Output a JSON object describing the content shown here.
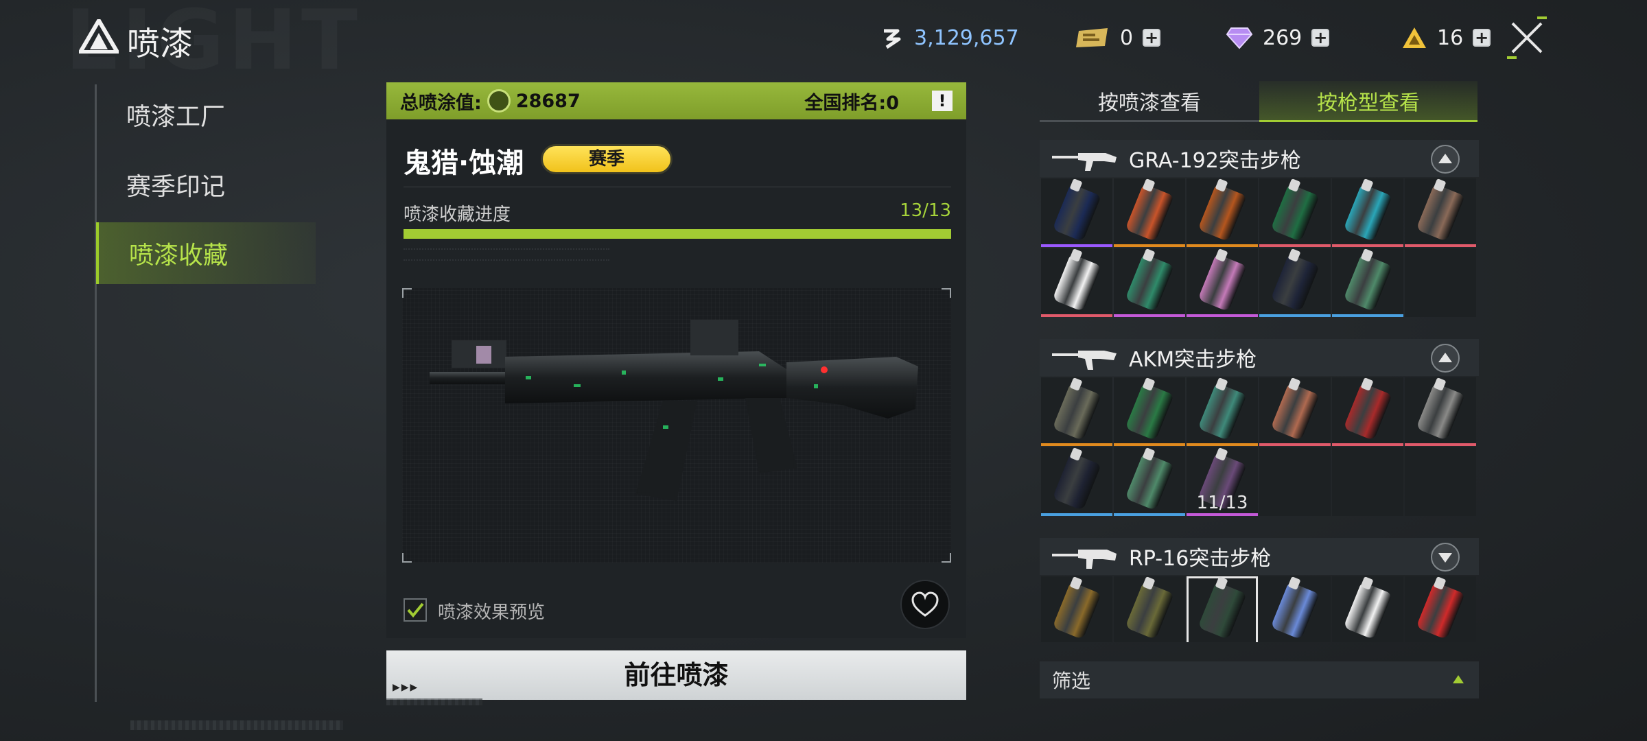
{
  "app": {
    "title": "喷漆",
    "bg_watermark": "LIGHT"
  },
  "currencies": [
    {
      "icon": "coin-icon",
      "value": "3,129,657",
      "color": "#8fc4ff"
    },
    {
      "icon": "ticket-icon",
      "value": "0",
      "color": "#f0f0f0"
    },
    {
      "icon": "diamond-icon",
      "value": "269",
      "color": "#f0f0f0"
    },
    {
      "icon": "triangle-token-icon",
      "value": "16",
      "color": "#f0f0f0"
    }
  ],
  "sidebar": {
    "items": [
      {
        "label": "喷漆工厂",
        "active": false
      },
      {
        "label": "赛季印记",
        "active": false
      },
      {
        "label": "喷漆收藏",
        "active": true
      }
    ]
  },
  "summary": {
    "total_label": "总喷涂值:",
    "total_value": "28687",
    "rank_label": "全国排名:0",
    "info_icon": "!"
  },
  "skin": {
    "name": "鬼猎·蚀潮",
    "badge": "赛季",
    "progress_label": "喷漆收藏进度",
    "progress_text": "13/13",
    "progress_fraction": 1.0,
    "preview_label": "喷漆效果预览",
    "preview_checked": true
  },
  "actions": {
    "go_label": "前往喷漆",
    "go_mark": "▶▶▶"
  },
  "tabs": [
    {
      "label": "按喷漆查看",
      "active": false
    },
    {
      "label": "按枪型查看",
      "active": true
    }
  ],
  "groups": [
    {
      "name": "GRA-192突击步枪",
      "expanded": true,
      "cells": [
        {
          "color": "#1b2a55",
          "rarity": "#9b59ff"
        },
        {
          "color": "#c9542a",
          "rarity": "#e08a1e"
        },
        {
          "color": "#b5561e",
          "rarity": "#e08a1e"
        },
        {
          "color": "#1f6e43",
          "rarity": "#e05a6a"
        },
        {
          "color": "#2aa6b8",
          "rarity": "#e05a6a"
        },
        {
          "color": "#8a6a58",
          "rarity": "#e05a6a"
        },
        {
          "color": "#f2f2f2",
          "rarity": "#e05a6a"
        },
        {
          "color": "#2f8b6a",
          "rarity": "#c45ad8"
        },
        {
          "color": "#c47ab8",
          "rarity": "#c45ad8"
        },
        {
          "color": "#1e2438",
          "rarity": "#4aa0e0"
        },
        {
          "color": "#4f8a6a",
          "rarity": "#4aa0e0"
        },
        {
          "color": "",
          "rarity": ""
        }
      ]
    },
    {
      "name": "AKM突击步枪",
      "expanded": true,
      "cells": [
        {
          "color": "#6a6b5a",
          "rarity": "#e08a1e"
        },
        {
          "color": "#2a7a45",
          "rarity": "#e08a1e"
        },
        {
          "color": "#3f8a7a",
          "rarity": "#e08a1e"
        },
        {
          "color": "#b06a50",
          "rarity": "#e05a6a"
        },
        {
          "color": "#a82a2a",
          "rarity": "#e05a6a"
        },
        {
          "color": "#8a8a88",
          "rarity": "#e05a6a"
        },
        {
          "color": "#1e2232",
          "rarity": "#4aa0e0"
        },
        {
          "color": "#4f8a6a",
          "rarity": "#4aa0e0"
        },
        {
          "color": "#6a4a78",
          "rarity": "#c45ad8",
          "progress": "11/13"
        },
        {
          "color": "",
          "rarity": ""
        },
        {
          "color": "",
          "rarity": ""
        },
        {
          "color": "",
          "rarity": ""
        }
      ]
    },
    {
      "name": "RP-16突击步枪",
      "expanded": false,
      "cells": [
        {
          "color": "#8a6a2a",
          "rarity": ""
        },
        {
          "color": "#6a6a38",
          "rarity": ""
        },
        {
          "color": "#2f4a3a",
          "rarity": "",
          "selected": true
        },
        {
          "color": "#6a8ad8",
          "rarity": ""
        },
        {
          "color": "#f2f2f2",
          "rarity": ""
        },
        {
          "color": "#d02a2a",
          "rarity": ""
        }
      ]
    }
  ],
  "filter": {
    "label": "筛选"
  }
}
